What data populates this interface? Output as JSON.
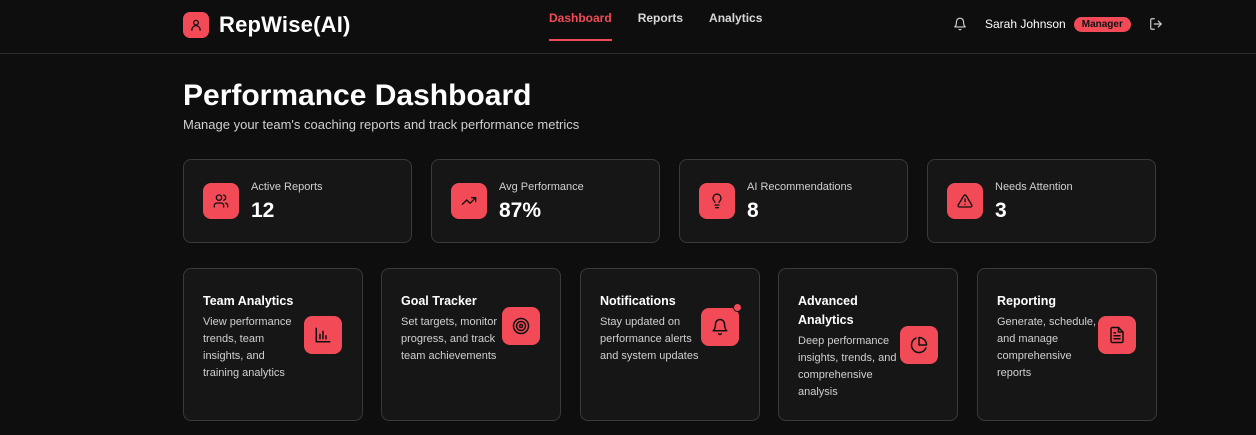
{
  "app": {
    "brand": "RepWise(AI)",
    "brand_icon": "user-icon",
    "accent_color": "#f24b57"
  },
  "nav": {
    "tabs": [
      {
        "label": "Dashboard",
        "active": true
      },
      {
        "label": "Reports",
        "active": false
      },
      {
        "label": "Analytics",
        "active": false
      }
    ]
  },
  "user": {
    "name": "Sarah Johnson",
    "role": "Manager",
    "notification_icon": "bell-icon",
    "logout_icon": "logout-icon"
  },
  "page": {
    "title": "Performance Dashboard",
    "subtitle": "Manage your team's coaching reports and track performance metrics"
  },
  "stats": [
    {
      "label": "Active Reports",
      "value": "12",
      "icon": "users-icon"
    },
    {
      "label": "Avg Performance",
      "value": "87%",
      "icon": "trending-up-icon"
    },
    {
      "label": "AI Recommendations",
      "value": "8",
      "icon": "lightbulb-icon"
    },
    {
      "label": "Needs Attention",
      "value": "3",
      "icon": "alert-triangle-icon"
    }
  ],
  "features": [
    {
      "title_lines": [
        "Team Analytics"
      ],
      "desc_lines": [
        "View performance",
        "trends, team",
        "insights, and",
        "training analytics"
      ],
      "icon": "bar-chart-icon"
    },
    {
      "title_lines": [
        "Goal Tracker"
      ],
      "desc_lines": [
        "Set targets, monitor",
        "progress, and track",
        "team achievements"
      ],
      "icon": "target-icon"
    },
    {
      "title_lines": [
        "Notifications"
      ],
      "desc_lines": [
        "Stay updated on",
        "performance alerts",
        "and system updates"
      ],
      "icon": "bell-icon"
    },
    {
      "title_lines": [
        "Advanced",
        "Analytics"
      ],
      "desc_lines": [
        "Deep performance",
        "insights, trends, and",
        "comprehensive",
        "analysis"
      ],
      "icon": "pie-chart-icon"
    },
    {
      "title_lines": [
        "Reporting"
      ],
      "desc_lines": [
        "Generate, schedule,",
        "and manage",
        "comprehensive",
        "reports"
      ],
      "icon": "file-text-icon"
    }
  ]
}
